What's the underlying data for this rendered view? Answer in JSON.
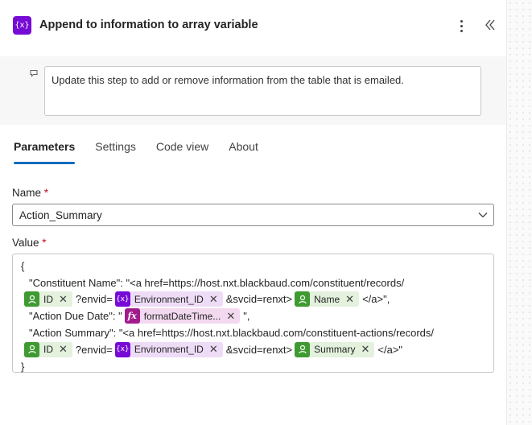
{
  "header": {
    "icon_text": "{x}",
    "title": "Append to information to array variable"
  },
  "note": {
    "text": "Update this step to add or remove information from the table that is emailed."
  },
  "tabs": [
    {
      "label": "Parameters",
      "active": true
    },
    {
      "label": "Settings",
      "active": false
    },
    {
      "label": "Code view",
      "active": false
    },
    {
      "label": "About",
      "active": false
    }
  ],
  "fields": {
    "name_label": "Name",
    "required_mark": "*",
    "name_value": "Action_Summary",
    "value_label": "Value"
  },
  "editor": {
    "open_brace": "{",
    "close_brace": "}",
    "line1": "\"Constituent Name\": \"<a href=https://host.nxt.blackbaud.com/constituent/records/",
    "line3": "\"Action Due Date\": \"",
    "line3_end": "\",",
    "line4": "\"Action Summary\": \"<a href=https://host.nxt.blackbaud.com/constituent-actions/records/",
    "envid_text": "?envid=",
    "svcid_text": "&svcid=renxt>",
    "close_anchor_comma": "</a>\",",
    "close_anchor": "</a>\"",
    "token_id": "ID",
    "token_env": "Environment_ID",
    "token_name": "Name",
    "token_date": "formatDateTime...",
    "token_summary": "Summary",
    "fx_text": "fx",
    "remove_glyph": "✕"
  }
}
